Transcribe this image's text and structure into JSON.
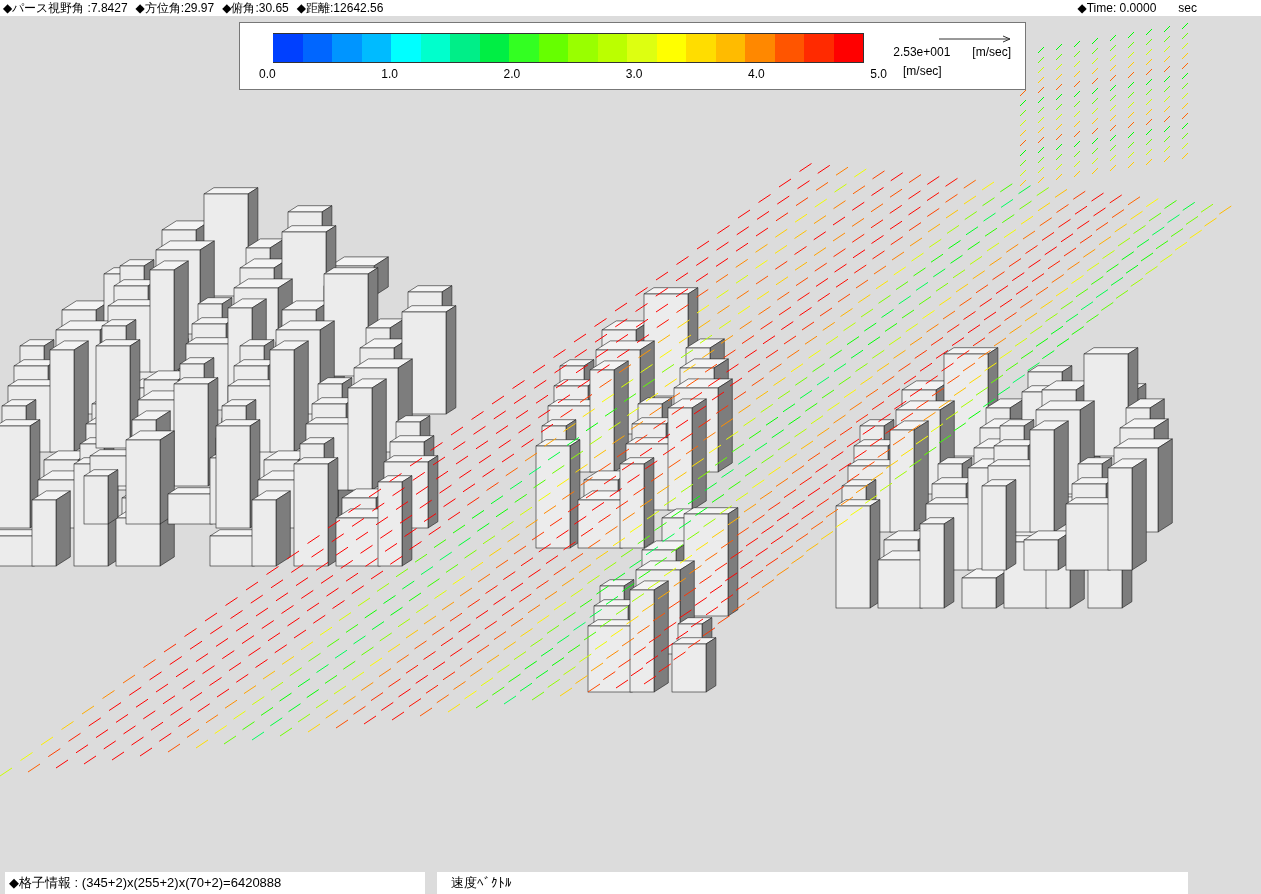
{
  "status_top": {
    "view_params": [
      "◆パース視野角 :7.8427",
      "◆方位角:29.97",
      "◆俯角:30.65",
      "◆距離:12642.56"
    ],
    "time": "◆Time: 0.0000",
    "time_unit": "sec"
  },
  "legend": {
    "swatches": [
      {
        "color": "#0040ff"
      },
      {
        "color": "#0066ff"
      },
      {
        "color": "#0095ff"
      },
      {
        "color": "#00bbff"
      },
      {
        "color": "#00ffff"
      },
      {
        "color": "#00ffcc"
      },
      {
        "color": "#00ee88"
      },
      {
        "color": "#00ee44"
      },
      {
        "color": "#33ff22"
      },
      {
        "color": "#66ff00"
      },
      {
        "color": "#99ff00"
      },
      {
        "color": "#bbff00"
      },
      {
        "color": "#ddff11"
      },
      {
        "color": "#ffff00"
      },
      {
        "color": "#ffdd00"
      },
      {
        "color": "#ffbb00"
      },
      {
        "color": "#ff8800"
      },
      {
        "color": "#ff5500"
      },
      {
        "color": "#ff2a00"
      },
      {
        "color": "#ff0000"
      }
    ],
    "ticks": [
      "0.0",
      "1.0",
      "2.0",
      "3.0",
      "4.0",
      "5.0"
    ],
    "unit": "[m/sec]",
    "reference_value": "2.53e+001",
    "reference_unit": "[m/sec]"
  },
  "status_bottom": {
    "grid_info": "◆格子情報 : (345+2)x(255+2)x(70+2)=6420888",
    "display_mode": "速度ﾍﾞｸﾄﾙ"
  }
}
